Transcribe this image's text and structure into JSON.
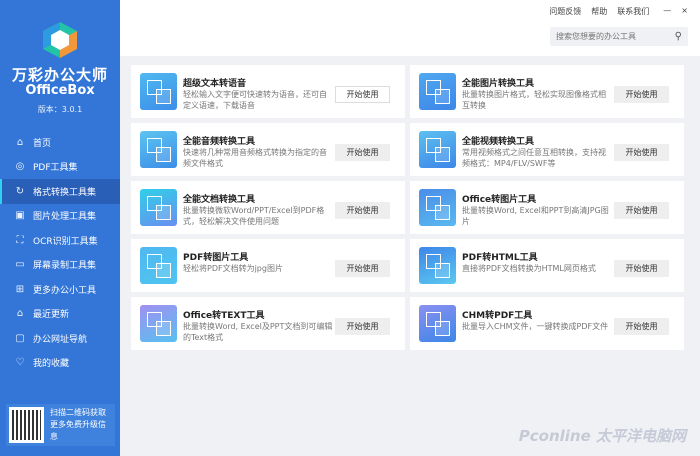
{
  "app": {
    "name_cn": "万彩办公大师",
    "name_en": "OfficeBox",
    "version": "版本：3.0.1"
  },
  "top": {
    "links": [
      "问题反馈",
      "帮助",
      "联系我们"
    ],
    "minimize": "—",
    "close": "×",
    "search_placeholder": "搜索您想要的办公工具"
  },
  "sidebar": {
    "items": [
      {
        "label": "首页",
        "icon": "home-icon",
        "g": "⌂"
      },
      {
        "label": "PDF工具集",
        "icon": "pdf-icon",
        "g": "◎"
      },
      {
        "label": "格式转换工具集",
        "icon": "refresh-icon",
        "g": "↻",
        "active": true
      },
      {
        "label": "图片处理工具集",
        "icon": "image-icon",
        "g": "▣"
      },
      {
        "label": "OCR识别工具集",
        "icon": "scan-icon",
        "g": "⛶"
      },
      {
        "label": "屏幕录制工具集",
        "icon": "monitor-icon",
        "g": "▭"
      },
      {
        "label": "更多办公小工具",
        "icon": "grid-icon",
        "g": "⊞"
      },
      {
        "label": "最近更新",
        "icon": "new-icon",
        "g": "⌂"
      },
      {
        "label": "办公网址导航",
        "icon": "browser-icon",
        "g": "▢"
      },
      {
        "label": "我的收藏",
        "icon": "heart-icon",
        "g": "♡"
      }
    ],
    "qr_text": [
      "扫描二维码获取",
      "更多免费升级信息"
    ]
  },
  "button_label": "开始使用",
  "tools": [
    {
      "title": "超级文本转语音",
      "desc": "轻松输入文字便可快速转为语音，还可自定义语速，下载语音"
    },
    {
      "title": "全能图片转换工具",
      "desc": "批量转换图片格式，轻松实现图像格式相互转换"
    },
    {
      "title": "全能音频转换工具",
      "desc": "快速将几种常用音频格式转换为指定的音频文件格式"
    },
    {
      "title": "全能视频转换工具",
      "desc": "常用视频格式之间任意互相转换，支持视频格式：MP4/FLV/SWF等"
    },
    {
      "title": "全能文档转换工具",
      "desc": "批量转换微软Word/PPT/Excel到PDF格式，轻松解决文件使用问题"
    },
    {
      "title": "Office转图片工具",
      "desc": "批量转换Word, Excel和PPT到高清JPG图片"
    },
    {
      "title": "PDF转图片工具",
      "desc": "轻松将PDF文档转为jpg图片"
    },
    {
      "title": "PDF转HTML工具",
      "desc": "直接将PDF文档转换为HTML网页格式"
    },
    {
      "title": "Office转TEXT工具",
      "desc": "批量转换Word, Excel及PPT文档到可编辑的Text格式"
    },
    {
      "title": "CHM转PDF工具",
      "desc": "批量导入CHM文件，一键转换成PDF文件"
    }
  ],
  "watermark": "Pconline 太平洋电脑网"
}
